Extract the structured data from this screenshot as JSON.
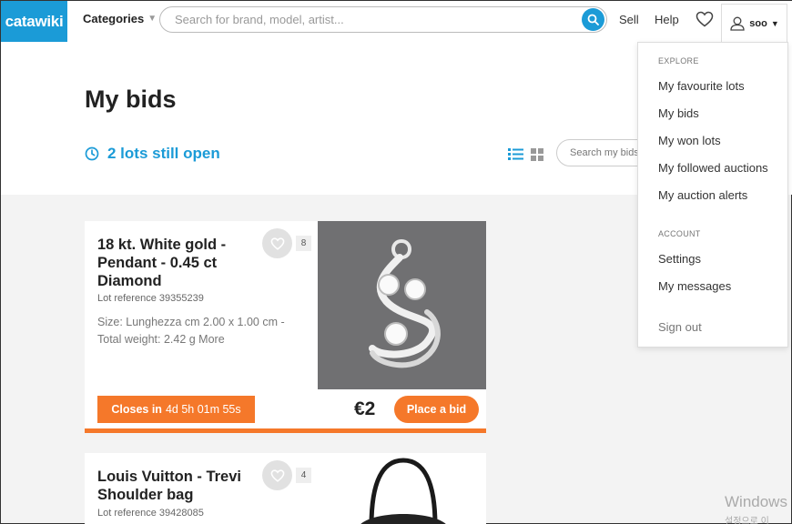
{
  "brand": {
    "logo_text": "catawiki",
    "color": "#1b9bd7",
    "accent": "#f5782a"
  },
  "topbar": {
    "categories_label": "Categories",
    "search_placeholder": "Search for brand, model, artist...",
    "sell_label": "Sell",
    "help_label": "Help",
    "user_label": "soo"
  },
  "header": {
    "title": "My bids",
    "open_lots": "2 lots still open",
    "search_bids_placeholder": "Search my bids"
  },
  "lots": [
    {
      "title": "18 kt. White gold - Pendant - 0.45 ct Diamond",
      "reference": "Lot reference 39355239",
      "description": "Size: Lunghezza cm 2.00 x 1.00 cm - Total weight: 2.42 g More",
      "favourites": "8",
      "closes_label": "Closes in",
      "closes_time": "4d 5h 01m 55s",
      "price": "€2",
      "bid_button": "Place a bid"
    },
    {
      "title": "Louis Vuitton - Trevi Shoulder bag",
      "reference": "Lot reference 39428085",
      "favourites": "4"
    }
  ],
  "dropdown": {
    "explore_heading": "EXPLORE",
    "explore_items": [
      "My favourite lots",
      "My bids",
      "My won lots",
      "My followed auctions",
      "My auction alerts"
    ],
    "account_heading": "ACCOUNT",
    "account_items": [
      "Settings",
      "My messages"
    ],
    "sign_out": "Sign out"
  },
  "watermark": {
    "line1": "Windows",
    "line2": "설정으로 이"
  }
}
